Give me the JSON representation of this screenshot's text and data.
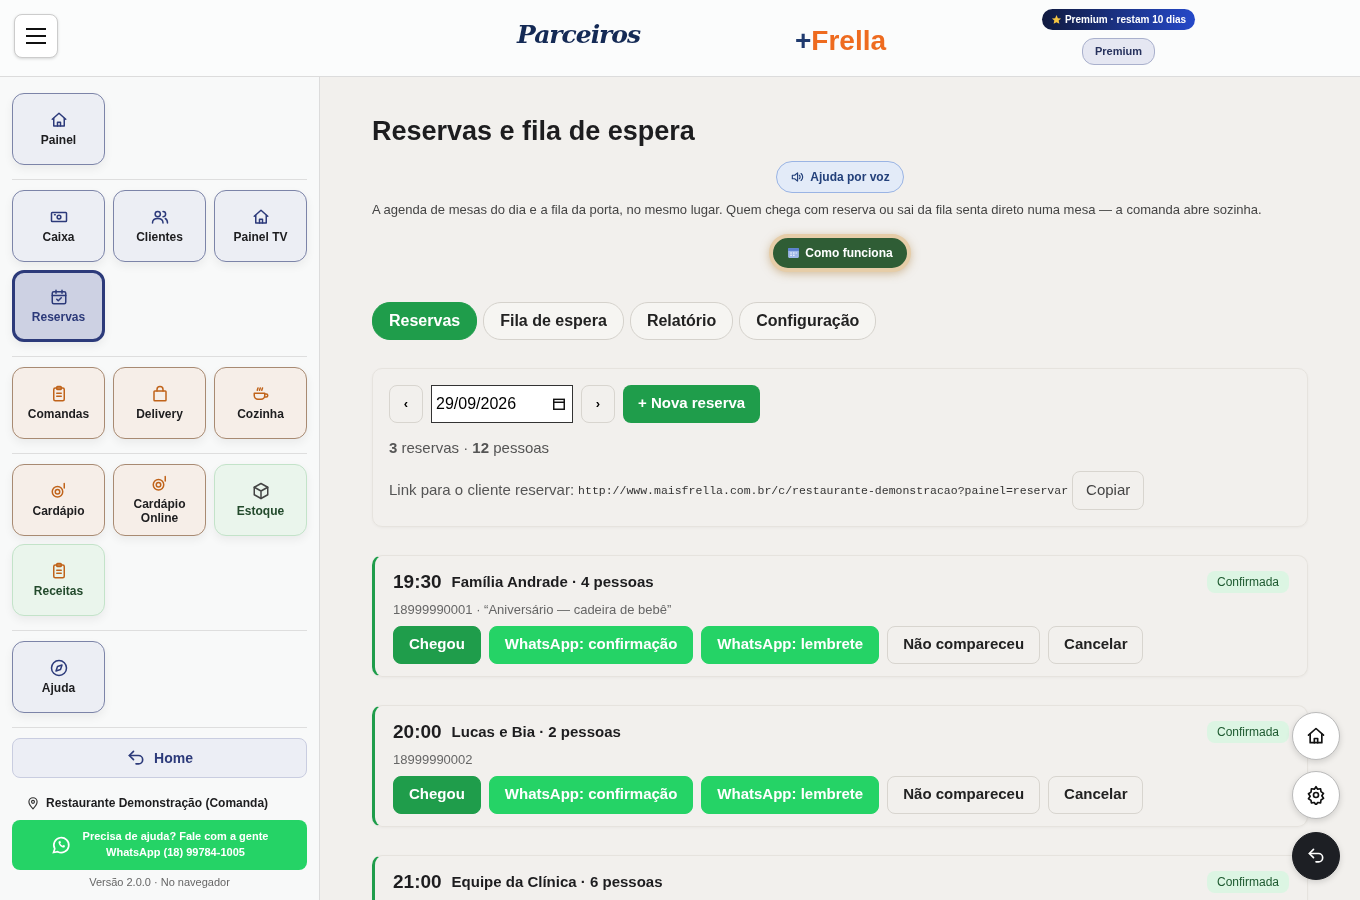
{
  "header": {
    "logo_left": "Parceiros",
    "logo_plus": "+",
    "logo_right": "Frella",
    "plan_badge": "Premium · restam 10 dias",
    "plan_pill": "Premium"
  },
  "sidebar": {
    "groups": [
      {
        "tiles": [
          {
            "label": "Painel",
            "kind": "admin",
            "selected": false
          }
        ]
      },
      {
        "tiles": [
          {
            "label": "Caixa",
            "kind": "admin",
            "selected": false
          },
          {
            "label": "Clientes",
            "kind": "admin",
            "selected": false
          },
          {
            "label": "Painel TV",
            "kind": "admin",
            "selected": false
          },
          {
            "label": "Reservas",
            "kind": "admin",
            "selected": true
          }
        ]
      },
      {
        "tiles": [
          {
            "label": "Comandas",
            "kind": "service",
            "selected": false
          },
          {
            "label": "Delivery",
            "kind": "service",
            "selected": false
          },
          {
            "label": "Cozinha",
            "kind": "service",
            "selected": false
          }
        ]
      },
      {
        "tiles": [
          {
            "label": "Cardápio",
            "kind": "service",
            "selected": false
          },
          {
            "label": "Cardápio Online",
            "kind": "service",
            "selected": false
          },
          {
            "label": "Estoque",
            "kind": "stock",
            "selected": false
          },
          {
            "label": "Receitas",
            "kind": "stock",
            "selected": false
          }
        ]
      },
      {
        "tiles": [
          {
            "label": "Ajuda",
            "kind": "admin",
            "selected": false
          }
        ]
      }
    ],
    "home_button": "Home",
    "location": "Restaurante Demonstração (Comanda)",
    "help_button": {
      "line_1": "Precisa de ajuda? Fale com a gente",
      "line_2": "WhatsApp (18) 99784-1005"
    },
    "version": "Versão 2.0.0 · No navegador"
  },
  "page": {
    "title": "Reservas e fila de espera",
    "voice_help": "Ajuda por voz",
    "description": "A agenda de mesas do dia e a fila da porta, no mesmo lugar. Quem chega com reserva ou sai da fila senta direto numa mesa — a comanda abre sozinha.",
    "how_it_works": "Como funciona",
    "tabs": [
      {
        "label": "Reservas",
        "selected": true
      },
      {
        "label": "Fila de espera",
        "selected": false
      },
      {
        "label": "Relatório",
        "selected": false
      },
      {
        "label": "Configuração",
        "selected": false
      }
    ],
    "day": {
      "prev": "‹",
      "date": "29/09/2026",
      "next": "›",
      "new_button": "+ Nova reserva",
      "summary": "**3** reservas · **12** pessoas",
      "link_label": "Link para o cliente reservar:",
      "link_url": "http://www.maisfrella.com.br/c/restaurante-demonstracao?painel=reservar",
      "copy_button": "Copiar"
    },
    "reservations": [
      {
        "time": "19:30",
        "title": "Família Andrade · 4 pessoas",
        "details": "18999990001 · “Aniversário — cadeira de bebê”",
        "status": "Confirmada",
        "actions": [
          {
            "label": "Chegou",
            "kind": "arrived"
          },
          {
            "label": "WhatsApp: confirmação",
            "kind": "whatsapp"
          },
          {
            "label": "WhatsApp: lembrete",
            "kind": "whatsapp"
          },
          {
            "label": "Não compareceu",
            "kind": "plain"
          },
          {
            "label": "Cancelar",
            "kind": "plain"
          }
        ]
      },
      {
        "time": "20:00",
        "title": "Lucas e Bia · 2 pessoas",
        "details": "18999990002",
        "status": "Confirmada",
        "actions": [
          {
            "label": "Chegou",
            "kind": "arrived"
          },
          {
            "label": "WhatsApp: confirmação",
            "kind": "whatsapp"
          },
          {
            "label": "WhatsApp: lembrete",
            "kind": "whatsapp"
          },
          {
            "label": "Não compareceu",
            "kind": "plain"
          },
          {
            "label": "Cancelar",
            "kind": "plain"
          }
        ]
      },
      {
        "time": "21:00",
        "title": "Equipe da Clínica · 6 pessoas",
        "status": "Confirmada"
      }
    ]
  }
}
